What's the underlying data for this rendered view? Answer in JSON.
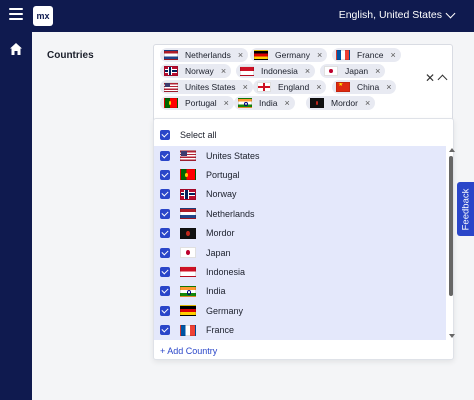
{
  "topbar": {
    "logo_text": "mx",
    "language": "English, United States"
  },
  "form": {
    "label": "Countries",
    "selected_chips": [
      {
        "label": "Netherlands",
        "flag": "f-nl"
      },
      {
        "label": "Germany",
        "flag": "f-de"
      },
      {
        "label": "France",
        "flag": "f-fr"
      },
      {
        "label": "Norway",
        "flag": "f-no"
      },
      {
        "label": "Indonesia",
        "flag": "f-id"
      },
      {
        "label": "Japan",
        "flag": "f-jp"
      },
      {
        "label": "Unites States",
        "flag": "f-us"
      },
      {
        "label": "England",
        "flag": "f-en"
      },
      {
        "label": "China",
        "flag": "f-cn"
      },
      {
        "label": "Portugal",
        "flag": "f-pt"
      },
      {
        "label": "India",
        "flag": "f-in"
      },
      {
        "label": "Mordor",
        "flag": "f-mo"
      }
    ],
    "chip_remove_glyph": "×",
    "clear_glyph": "✕"
  },
  "dropdown": {
    "select_all_label": "Select all",
    "options": [
      {
        "label": "Unites States",
        "flag": "f-us",
        "checked": true
      },
      {
        "label": "Portugal",
        "flag": "f-pt",
        "checked": true
      },
      {
        "label": "Norway",
        "flag": "f-no",
        "checked": true
      },
      {
        "label": "Netherlands",
        "flag": "f-nl",
        "checked": true
      },
      {
        "label": "Mordor",
        "flag": "f-mo",
        "checked": true
      },
      {
        "label": "Japan",
        "flag": "f-jp",
        "checked": true
      },
      {
        "label": "Indonesia",
        "flag": "f-id",
        "checked": true
      },
      {
        "label": "India",
        "flag": "f-in",
        "checked": true
      },
      {
        "label": "Germany",
        "flag": "f-de",
        "checked": true
      },
      {
        "label": "France",
        "flag": "f-fr",
        "checked": true
      }
    ],
    "add_label": "+ Add Country"
  },
  "feedback_label": "Feedback",
  "colors": {
    "nav_bg": "#0f1a4f",
    "accent": "#2a46c9",
    "selected_bg": "#e4e8fb"
  }
}
